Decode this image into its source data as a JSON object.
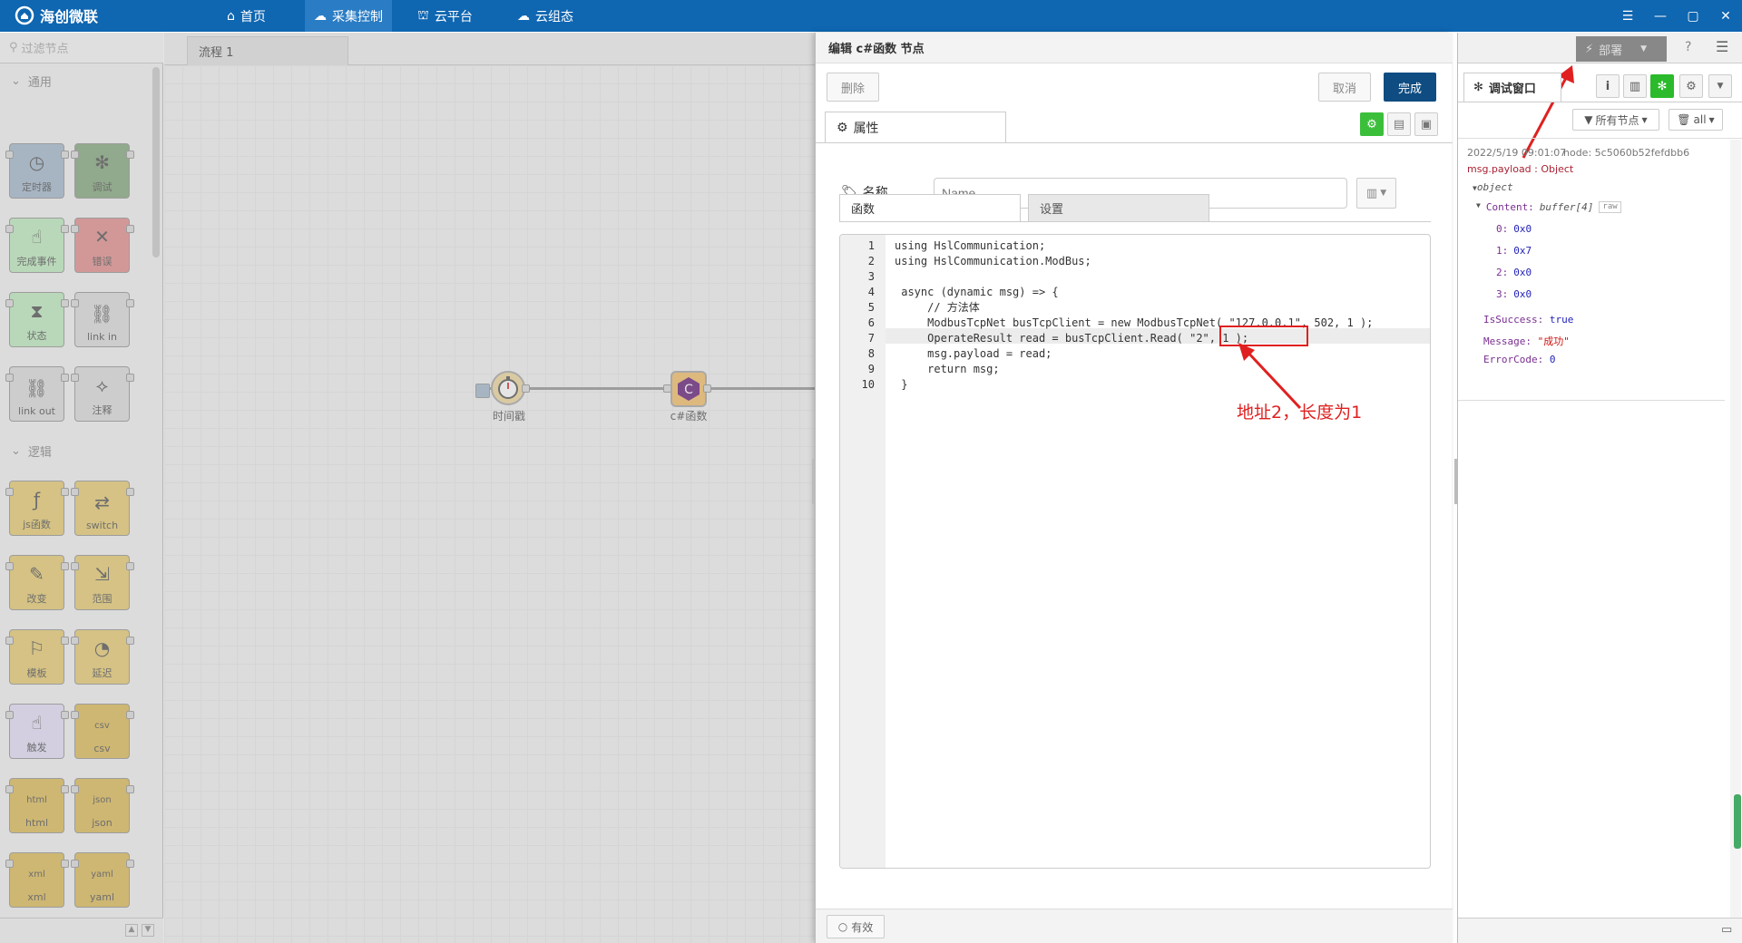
{
  "app": {
    "title": "海创微联"
  },
  "nav": [
    {
      "label": "首页"
    },
    {
      "label": "采集控制"
    },
    {
      "label": "云平台"
    },
    {
      "label": "云组态"
    }
  ],
  "palette": {
    "filter_placeholder": "过滤节点",
    "categories": [
      {
        "label": "通用",
        "nodes": [
          {
            "label": "定时器",
            "color": "#a6bbcf"
          },
          {
            "label": "调试",
            "color": "#87a980"
          },
          {
            "label": "完成事件",
            "color": "#c0edc0"
          },
          {
            "label": "错误",
            "color": "#e49191"
          },
          {
            "label": "状态",
            "color": "#c0edc0"
          },
          {
            "label": "link in",
            "color": "#dddddd"
          },
          {
            "label": "link out",
            "color": "#dddddd"
          },
          {
            "label": "注释",
            "color": "#dddddd"
          }
        ]
      },
      {
        "label": "逻辑",
        "nodes": [
          {
            "label": "js函数",
            "color": "#e8cd74"
          },
          {
            "label": "switch",
            "color": "#e8cd74"
          },
          {
            "label": "改变",
            "color": "#e8cd74"
          },
          {
            "label": "范围",
            "color": "#e8cd74"
          },
          {
            "label": "模板",
            "color": "#e8cd74"
          },
          {
            "label": "延迟",
            "color": "#e8cd74"
          },
          {
            "label": "触发",
            "color": "#e6e0f8"
          },
          {
            "label": "csv",
            "color": "#debd5c"
          },
          {
            "label": "html",
            "color": "#debd5c"
          },
          {
            "label": "json",
            "color": "#debd5c"
          },
          {
            "label": "xml",
            "color": "#debd5c"
          },
          {
            "label": "yaml",
            "color": "#debd5c"
          }
        ]
      }
    ]
  },
  "workspace": {
    "tab_label": "流程 1",
    "flow_nodes": [
      {
        "label": "时间戳"
      },
      {
        "label": "c#函数"
      }
    ]
  },
  "editor": {
    "title": "编辑 c#函数 节点",
    "delete_label": "删除",
    "cancel_label": "取消",
    "done_label": "完成",
    "props_tab": "属性",
    "name_label": "名称",
    "name_placeholder": "Name",
    "subtabs": [
      "函数",
      "设置"
    ],
    "code_lines": [
      "using HslCommunication;",
      "using HslCommunication.ModBus;",
      "",
      " async (dynamic msg) => {",
      "     // 方法体",
      "     ModbusTcpNet busTcpClient = new ModbusTcpNet( \"127.0.0.1\", 502, 1 );",
      "     OperateResult read = busTcpClient.Read( \"2\", 1 );",
      "     msg.payload = read;",
      "     return msg;",
      " }"
    ],
    "line_numbers": [
      "1",
      "2",
      "3",
      "4",
      "5",
      "6",
      "7",
      "8",
      "9",
      "10"
    ],
    "annotation": "地址2，长度为1",
    "enable_label": "有效"
  },
  "sidebar": {
    "deploy_label": "部署",
    "debug_tab": "调试窗口",
    "filter_nodes": "所有节点",
    "filter_all": "all",
    "message": {
      "timestamp": "2022/5/19 09:01:07",
      "node": "node: 5c5060b52fefdbb6",
      "topic": "msg.payload : Object",
      "object_label": "object",
      "content_key": "Content:",
      "content_type": "buffer[4]",
      "raw_label": "raw",
      "buffer": [
        {
          "idx": "0:",
          "val": "0x0"
        },
        {
          "idx": "1:",
          "val": "0x7"
        },
        {
          "idx": "2:",
          "val": "0x0"
        },
        {
          "idx": "3:",
          "val": "0x0"
        }
      ],
      "is_success_key": "IsSuccess:",
      "is_success_val": "true",
      "message_key": "Message:",
      "message_val": "\"成功\"",
      "error_key": "ErrorCode:",
      "error_val": "0"
    }
  }
}
